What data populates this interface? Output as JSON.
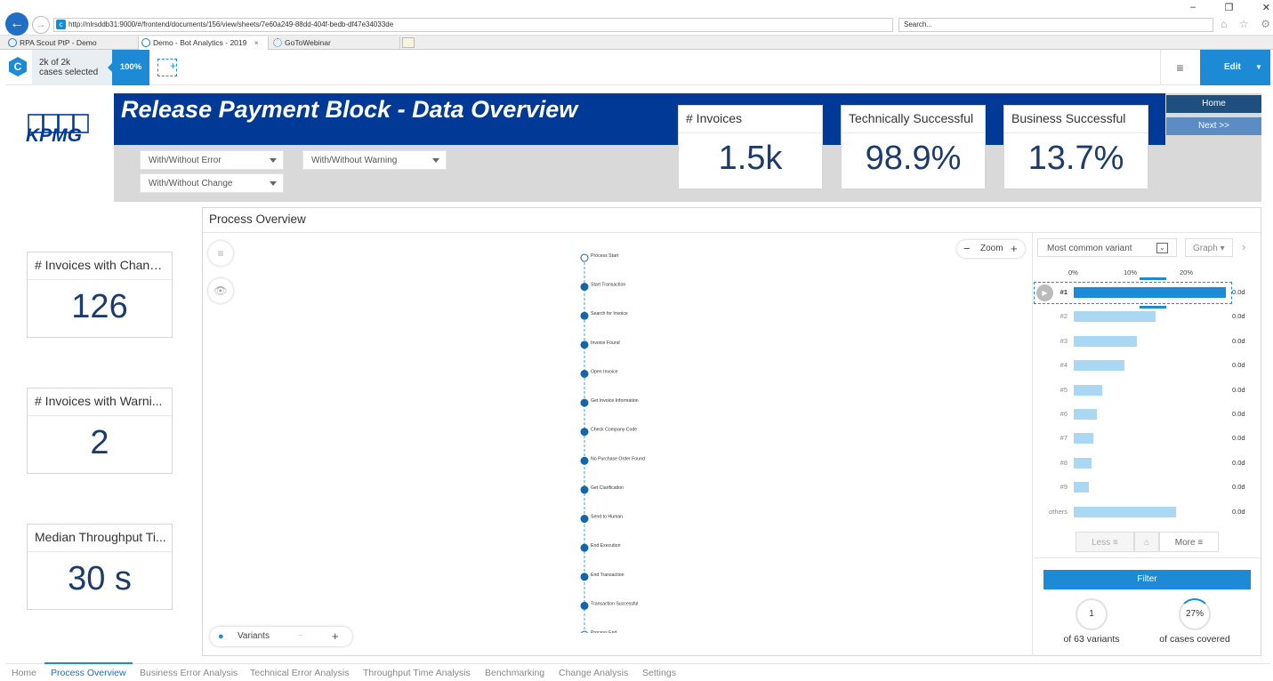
{
  "browser": {
    "url": "http://nlrsddb31:9000/#/frontend/documents/156/view/sheets/7e60a249-88dd-404f-bedb-df47e34033de",
    "search_placeholder": "Search...",
    "tabs": [
      {
        "label": "RPA Scout PtP - Demo",
        "active": false
      },
      {
        "label": "Demo - Bot Analytics - 2019",
        "active": true
      },
      {
        "label": "GoToWebinar",
        "active": false
      }
    ]
  },
  "app_bar": {
    "cases_line1": "2k of 2k",
    "cases_line2": "cases selected",
    "selection_percent": "100%",
    "edit_label": "Edit"
  },
  "header": {
    "logo_text": "KPMG",
    "title": "Release Payment Block - Data Overview",
    "filters": [
      "With/Without Error",
      "With/Without Warning",
      "With/Without Change"
    ],
    "nav": {
      "home": "Home",
      "next": "Next >>"
    }
  },
  "kpis_top": [
    {
      "label": "# Invoices",
      "value": "1.5k"
    },
    {
      "label": "Technically Successful",
      "value": "98.9%"
    },
    {
      "label": "Business Successful",
      "value": "13.7%"
    }
  ],
  "kpis_side": [
    {
      "label": "# Invoices with Changes",
      "value": "126"
    },
    {
      "label": "# Invoices with Warni...",
      "value": "2"
    },
    {
      "label": "Median Throughput Ti...",
      "value": "30 s"
    }
  ],
  "process_overview": {
    "title": "Process Overview",
    "zoom_label": "Zoom",
    "variants_label": "Variants",
    "activities": [
      "Process Start",
      "Start Transaction",
      "Search for Invoice",
      "Invoice Found",
      "Open Invoice",
      "Get Invoice Information",
      "Check Company Code",
      "No Purchase Order Found",
      "Get Clarification",
      "Send to Human",
      "End Execution",
      "End Transaction",
      "Transaction Successful",
      "Process End"
    ]
  },
  "variant_panel": {
    "dropdown": "Most common variant",
    "view": "Graph",
    "axis_ticks": [
      "0%",
      "10%",
      "20%"
    ],
    "variants": [
      {
        "label": "#1",
        "share": 27,
        "duration": "0.0d",
        "selected": true
      },
      {
        "label": "#2",
        "share": 14.5,
        "duration": "0.0d"
      },
      {
        "label": "#3",
        "share": 11.2,
        "duration": "0.0d"
      },
      {
        "label": "#4",
        "share": 8.9,
        "duration": "0.0d"
      },
      {
        "label": "#5",
        "share": 5.1,
        "duration": "0.0d"
      },
      {
        "label": "#6",
        "share": 4.1,
        "duration": "0.0d"
      },
      {
        "label": "#7",
        "share": 3.5,
        "duration": "0.0d"
      },
      {
        "label": "#8",
        "share": 3.2,
        "duration": "0.0d"
      },
      {
        "label": "#9",
        "share": 2.7,
        "duration": "0.0d"
      },
      {
        "label": "others",
        "share": 18.1,
        "duration": "0.0d"
      }
    ],
    "less_label": "Less",
    "more_label": "More",
    "filter_label": "Filter",
    "variants_count": "1",
    "variants_caption": "of 63 variants",
    "cases_covered": "27%",
    "cases_caption": "of cases covered"
  },
  "bottom_tabs": [
    "Home",
    "Process Overview",
    "Business Error Analysis",
    "Technical Error Analysis",
    "Throughput Time Analysis",
    "Benchmarking",
    "Change Analysis",
    "Settings"
  ],
  "colors": {
    "accent": "#1c8ad4",
    "banner": "#003a96",
    "kpi_value": "#1d3b6b"
  }
}
